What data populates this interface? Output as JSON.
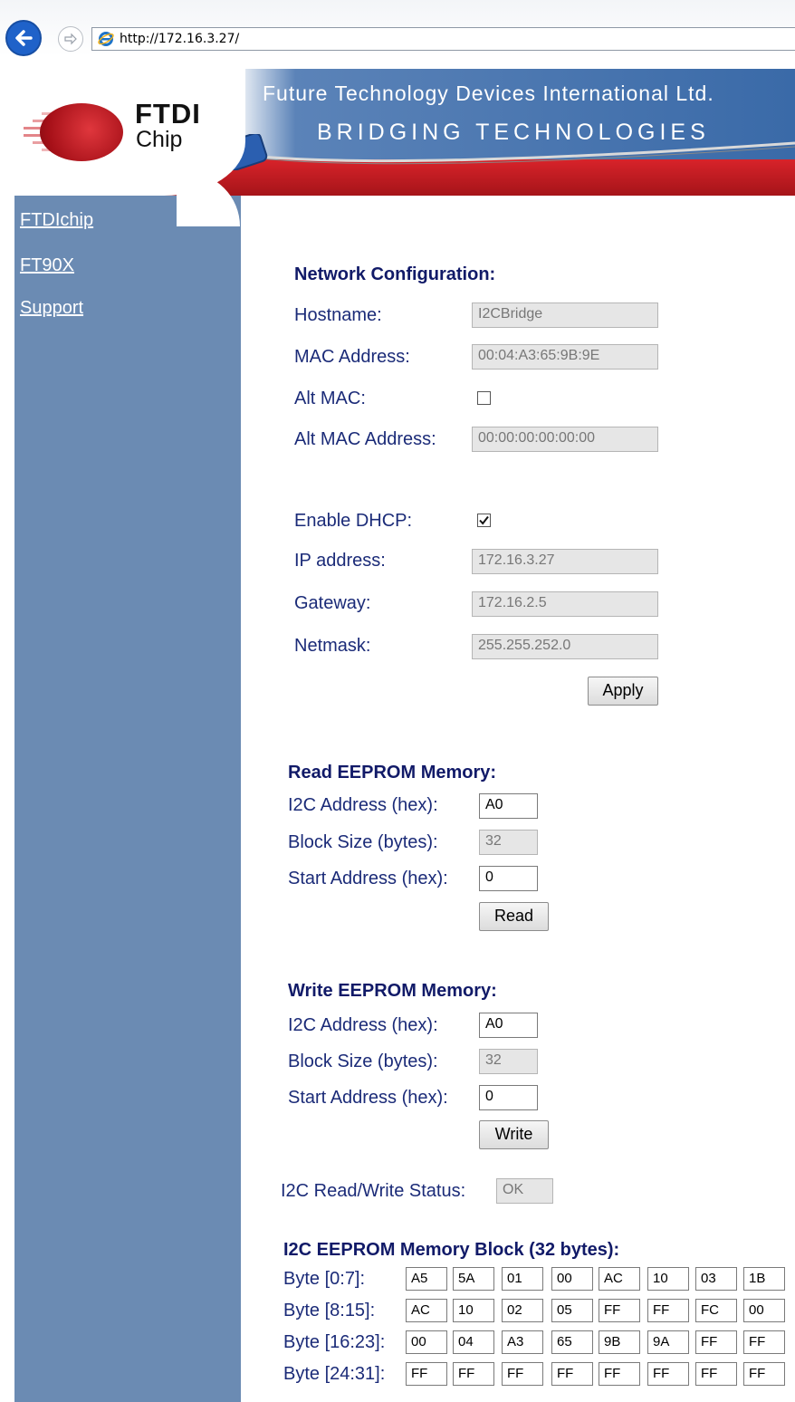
{
  "browser": {
    "url": "http://172.16.3.27/"
  },
  "banner": {
    "logo_ftdi": "FTDI",
    "logo_chip": "Chip",
    "company": "Future Technology Devices International Ltd.",
    "tagline": "BRIDGING TECHNOLOGIES"
  },
  "sidebar": {
    "links": [
      "FTDIchip",
      "FT90X",
      "Support"
    ]
  },
  "network": {
    "title": "Network Configuration:",
    "hostname_label": "Hostname:",
    "hostname": "I2CBridge",
    "mac_label": "MAC Address:",
    "mac": "00:04:A3:65:9B:9E",
    "altmac_label": "Alt MAC:",
    "altmac_checked": false,
    "altmac_addr_label": "Alt MAC Address:",
    "altmac_addr": "00:00:00:00:00:00",
    "dhcp_label": "Enable DHCP:",
    "dhcp_checked": true,
    "ip_label": "IP address:",
    "ip": "172.16.3.27",
    "gateway_label": "Gateway:",
    "gateway": "172.16.2.5",
    "netmask_label": "Netmask:",
    "netmask": "255.255.252.0",
    "apply_label": "Apply"
  },
  "read": {
    "title": "Read EEPROM Memory:",
    "addr_label": "I2C Address (hex):",
    "addr": "A0",
    "size_label": "Block Size (bytes):",
    "size": "32",
    "start_label": "Start Address (hex):",
    "start": "0",
    "button": "Read"
  },
  "write": {
    "title": "Write EEPROM Memory:",
    "addr_label": "I2C Address (hex):",
    "addr": "A0",
    "size_label": "Block Size (bytes):",
    "size": "32",
    "start_label": "Start Address (hex):",
    "start": "0",
    "button": "Write"
  },
  "status": {
    "label": "I2C Read/Write Status:",
    "value": "OK"
  },
  "memory": {
    "title": "I2C EEPROM Memory Block (32 bytes):",
    "rows": [
      {
        "label": "Byte [0:7]:",
        "bytes": [
          "A5",
          "5A",
          "01",
          "00",
          "AC",
          "10",
          "03",
          "1B"
        ]
      },
      {
        "label": "Byte [8:15]:",
        "bytes": [
          "AC",
          "10",
          "02",
          "05",
          "FF",
          "FF",
          "FC",
          "00"
        ]
      },
      {
        "label": "Byte [16:23]:",
        "bytes": [
          "00",
          "04",
          "A3",
          "65",
          "9B",
          "9A",
          "FF",
          "FF"
        ]
      },
      {
        "label": "Byte [24:31]:",
        "bytes": [
          "FF",
          "FF",
          "FF",
          "FF",
          "FF",
          "FF",
          "FF",
          "FF"
        ]
      }
    ]
  }
}
